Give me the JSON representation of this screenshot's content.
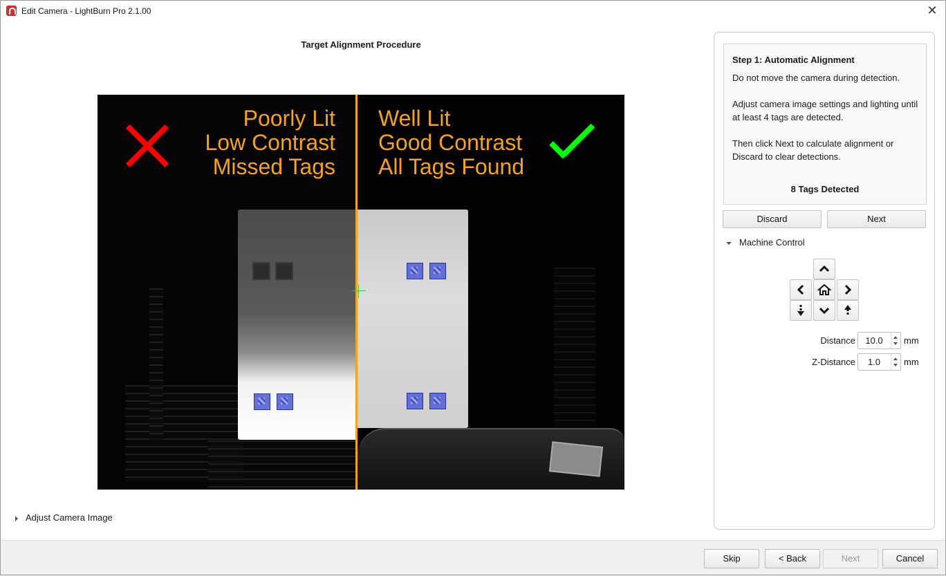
{
  "window": {
    "title": "Edit Camera - LightBurn Pro 2.1.00",
    "close_label": "✕"
  },
  "procedure_title": "Target Alignment Procedure",
  "camera_view": {
    "bad_lines": [
      "Poorly Lit",
      "Low Contrast",
      "Missed Tags"
    ],
    "good_lines": [
      "Well Lit",
      "Good Contrast",
      "All Tags Found"
    ],
    "accent_color": "#f5a31a"
  },
  "adjust_camera_label": "Adjust Camera Image",
  "step": {
    "heading": "Step 1: Automatic Alignment",
    "line1": "Do not move the camera during detection.",
    "line2": "Adjust camera image settings and lighting until at least 4 tags are detected.",
    "line3": "Then click Next to calculate alignment or Discard to clear detections.",
    "tags_detected": "8 Tags Detected"
  },
  "panel_buttons": {
    "discard": "Discard",
    "next": "Next"
  },
  "machine_control": {
    "label": "Machine Control",
    "distance_label": "Distance",
    "distance_value": "10.0",
    "zdistance_label": "Z-Distance",
    "zdistance_value": "1.0",
    "unit": "mm"
  },
  "footer": {
    "skip": "Skip",
    "back": "< Back",
    "next": "Next",
    "cancel": "Cancel"
  }
}
